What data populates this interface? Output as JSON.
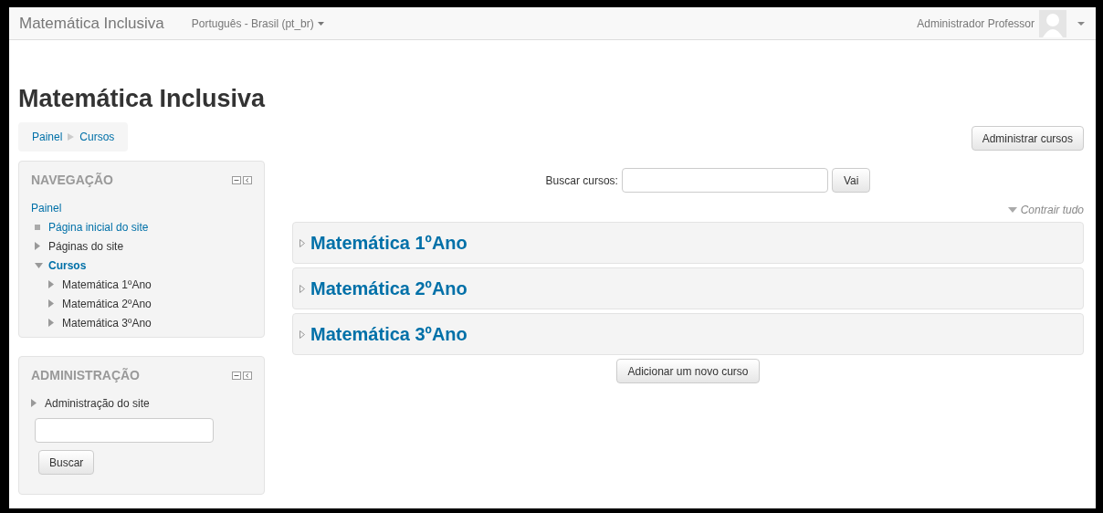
{
  "navbar": {
    "brand": "Matemática Inclusiva",
    "language": "Português - Brasil (pt_br)",
    "user_name": "Administrador Professor"
  },
  "page_title": "Matemática Inclusiva",
  "breadcrumb": [
    "Painel",
    "Cursos"
  ],
  "manage_button": "Administrar cursos",
  "navigation": {
    "title": "NAVEGAÇÃO",
    "items": [
      {
        "label": "Painel",
        "kind": "root",
        "selected": false,
        "children": [
          {
            "label": "Página inicial do site",
            "kind": "leaf",
            "selected": false
          },
          {
            "label": "Páginas do site",
            "kind": "branch",
            "expanded": false,
            "selected": false
          },
          {
            "label": "Cursos",
            "kind": "branch",
            "expanded": true,
            "selected": true,
            "children": [
              {
                "label": "Matemática 1ºAno",
                "kind": "branch",
                "expanded": false,
                "selected": false
              },
              {
                "label": "Matemática 2ºAno",
                "kind": "branch",
                "expanded": false,
                "selected": false
              },
              {
                "label": "Matemática 3ºAno",
                "kind": "branch",
                "expanded": false,
                "selected": false
              }
            ]
          }
        ]
      }
    ]
  },
  "administration": {
    "title": "ADMINISTRAÇÃO",
    "items": [
      {
        "label": "Administração do site",
        "kind": "branch",
        "expanded": false,
        "selected": false
      }
    ],
    "search_button": "Buscar"
  },
  "course_search": {
    "label": "Buscar cursos:",
    "button": "Vai"
  },
  "collapse_all": "Contrair tudo",
  "courses": [
    {
      "name": "Matemática 1ºAno",
      "expanded": false
    },
    {
      "name": "Matemática 2ºAno",
      "expanded": false
    },
    {
      "name": "Matemática 3ºAno",
      "expanded": false
    }
  ],
  "add_button": "Adicionar um novo curso"
}
